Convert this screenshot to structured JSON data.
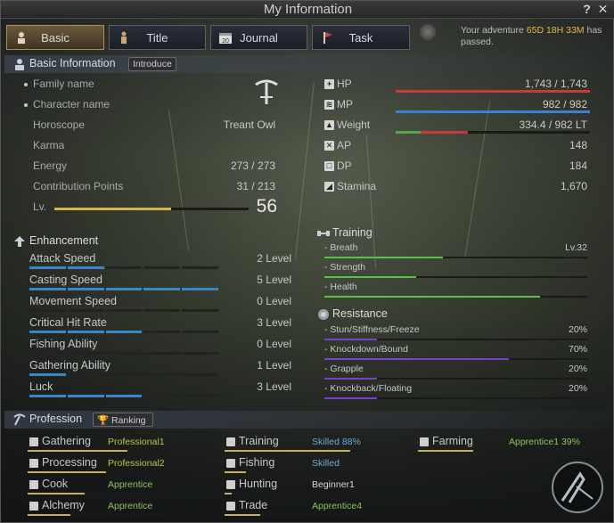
{
  "window": {
    "title": "My Information",
    "help_label": "?",
    "close_label": "✕"
  },
  "tabs": [
    "Basic",
    "Title",
    "Journal",
    "Task"
  ],
  "adventure": {
    "prefix": "Your adventure",
    "time": "65D 18H 33M",
    "suffix": "has passed."
  },
  "basic": {
    "title": "Basic Information",
    "introduce_label": "Introduce",
    "rows": [
      {
        "label": "Family name"
      },
      {
        "label": "Character name"
      },
      {
        "label": "Horoscope",
        "value": "Treant Owl"
      },
      {
        "label": "Karma"
      },
      {
        "label": "Energy",
        "value": "273 / 273"
      },
      {
        "label": "Contribution Points",
        "value": "31 / 213"
      }
    ],
    "level_label": "Lv.",
    "level": "56",
    "level_progress": 0.6
  },
  "stats": [
    {
      "label": "HP",
      "value": "1,743 / 1,743",
      "fill": 1.0
    },
    {
      "label": "MP",
      "value": "982 / 982",
      "fill": 1.0
    },
    {
      "label": "Weight",
      "value": "334.4 / 982 LT"
    },
    {
      "label": "AP",
      "value": "148"
    },
    {
      "label": "DP",
      "value": "184"
    },
    {
      "label": "Stamina",
      "value": "1,670"
    }
  ],
  "enhancement": {
    "title": "Enhancement",
    "segments": 5,
    "items": [
      {
        "name": "Attack Speed",
        "value": "2 Level",
        "level": 2
      },
      {
        "name": "Casting Speed",
        "value": "5 Level",
        "level": 5
      },
      {
        "name": "Movement Speed",
        "value": "0 Level",
        "level": 0
      },
      {
        "name": "Critical Hit Rate",
        "value": "3 Level",
        "level": 3
      },
      {
        "name": "Fishing Ability",
        "value": "0 Level",
        "level": 0
      },
      {
        "name": "Gathering Ability",
        "value": "1 Level",
        "level": 1
      },
      {
        "name": "Luck",
        "value": "3 Level",
        "level": 3
      }
    ]
  },
  "training": {
    "title": "Training",
    "items": [
      {
        "name": "- Breath",
        "value": "Lv.32",
        "fill": 0.45,
        "color": "#5cbf4a"
      },
      {
        "name": "- Strength",
        "value": "",
        "fill": 0.35,
        "color": "#5cbf4a"
      },
      {
        "name": "- Health",
        "value": "",
        "fill": 0.82,
        "color": "#5cbf4a"
      }
    ]
  },
  "resistance": {
    "title": "Resistance",
    "items": [
      {
        "name": "- Stun/Stiffness/Freeze",
        "value": "20%",
        "fill": 0.2,
        "color": "#7a3fd0"
      },
      {
        "name": "- Knockdown/Bound",
        "value": "70%",
        "fill": 0.7,
        "color": "#7a3fd0"
      },
      {
        "name": "- Grapple",
        "value": "20%",
        "fill": 0.2,
        "color": "#7a3fd0"
      },
      {
        "name": "- Knockback/Floating",
        "value": "20%",
        "fill": 0.2,
        "color": "#7a3fd0"
      }
    ]
  },
  "profession": {
    "title": "Profession",
    "ranking_label": "Ranking",
    "items": [
      {
        "name": "Gathering",
        "rank": "Professional1",
        "tone": "yellow",
        "progress": 0.7
      },
      {
        "name": "Processing",
        "rank": "Professional2",
        "tone": "yellow",
        "progress": 0.55
      },
      {
        "name": "Cook",
        "rank": "Apprentice",
        "tone": "green",
        "progress": 0.4
      },
      {
        "name": "Alchemy",
        "rank": "Apprentice",
        "tone": "green",
        "progress": 0.3
      },
      {
        "name": "Training",
        "rank": "Skilled",
        "tone": "blue",
        "progress": 0.88,
        "pct": "88%"
      },
      {
        "name": "Fishing",
        "rank": "Skilled",
        "tone": "blue",
        "progress": 0.15
      },
      {
        "name": "Hunting",
        "rank": "Beginner1",
        "tone": "white",
        "progress": 0.05
      },
      {
        "name": "Trade",
        "rank": "Apprentice4",
        "tone": "green",
        "progress": 0.25
      },
      {
        "name": "Farming",
        "rank": "Apprentice1",
        "tone": "green",
        "progress": 0.39,
        "pct": "39%"
      }
    ]
  }
}
